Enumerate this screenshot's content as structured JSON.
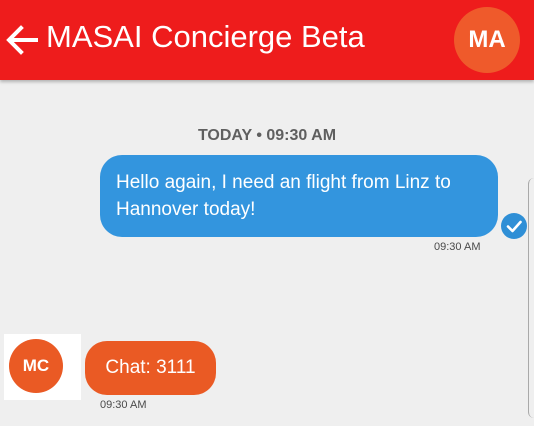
{
  "header": {
    "back_icon": "arrow-left-icon",
    "title": "MASAI Concierge Beta",
    "avatar_initials": "MA",
    "bar_color": "#ee1c1c",
    "avatar_color": "#ef5a2b"
  },
  "chat": {
    "date_separator": "TODAY • 09:30 AM",
    "messages": [
      {
        "direction": "outgoing",
        "text": "Hello again, I need an flight from Linz to Hannover today!",
        "time": "09:30 AM",
        "status_icon": "check-circle-icon",
        "bubble_color": "#3395de"
      },
      {
        "direction": "incoming",
        "sender_initials": "MC",
        "text": "Chat: 3111",
        "time": "09:30 AM",
        "bubble_color": "#ea5a24"
      }
    ]
  }
}
